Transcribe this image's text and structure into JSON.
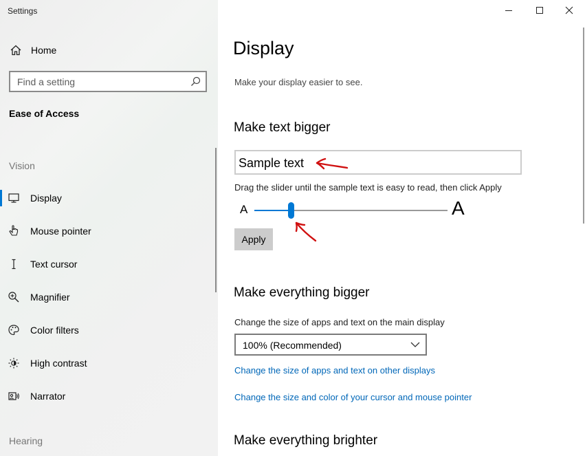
{
  "window": {
    "title": "Settings",
    "controls": [
      "minimize",
      "maximize",
      "close"
    ]
  },
  "sidebar": {
    "home_label": "Home",
    "search_placeholder": "Find a setting",
    "section": "Ease of Access",
    "groups": [
      {
        "label": "Vision",
        "items": [
          {
            "label": "Display",
            "icon": "monitor-icon",
            "active": true
          },
          {
            "label": "Mouse pointer",
            "icon": "pointer-icon"
          },
          {
            "label": "Text cursor",
            "icon": "text-cursor-icon"
          },
          {
            "label": "Magnifier",
            "icon": "magnifier-icon"
          },
          {
            "label": "Color filters",
            "icon": "palette-icon"
          },
          {
            "label": "High contrast",
            "icon": "brightness-icon"
          },
          {
            "label": "Narrator",
            "icon": "narrator-icon"
          }
        ]
      },
      {
        "label": "Hearing",
        "items": []
      }
    ]
  },
  "main": {
    "title": "Display",
    "subtitle": "Make your display easier to see.",
    "text_bigger": {
      "heading": "Make text bigger",
      "sample": "Sample text",
      "hint": "Drag the slider until the sample text is easy to read, then click Apply",
      "slider_min_label": "A",
      "slider_max_label": "A",
      "slider_value_fraction": 0.19,
      "apply_label": "Apply"
    },
    "everything_bigger": {
      "heading": "Make everything bigger",
      "field_label": "Change the size of apps and text on the main display",
      "select_value": "100% (Recommended)",
      "link_other_displays": "Change the size of apps and text on other displays",
      "link_cursor": "Change the size and color of your cursor and mouse pointer"
    },
    "brighter": {
      "heading": "Make everything brighter"
    }
  },
  "colors": {
    "accent": "#0078d4",
    "link": "#0067b8",
    "annotation": "#d01010"
  }
}
